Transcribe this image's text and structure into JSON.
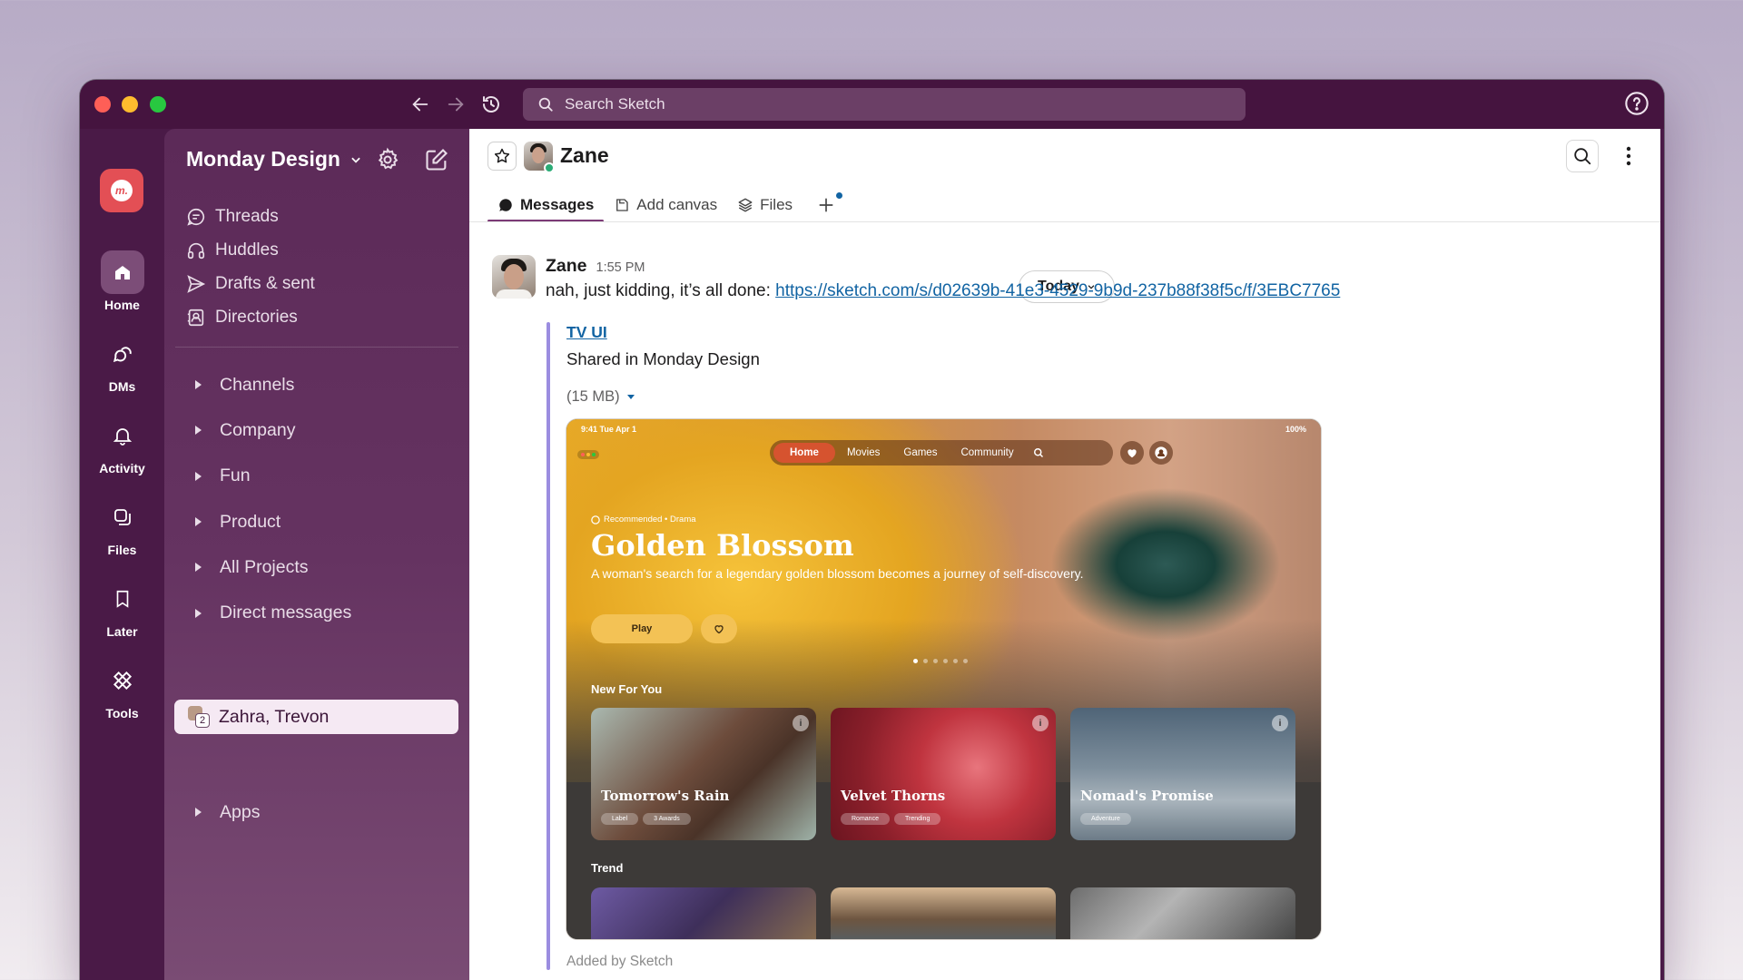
{
  "window": {
    "search_placeholder": "Search Sketch"
  },
  "rail": {
    "workspace_initial": "m.",
    "items": [
      {
        "label": "Home",
        "icon": "home-icon",
        "active": true
      },
      {
        "label": "DMs",
        "icon": "dms-icon",
        "active": false
      },
      {
        "label": "Activity",
        "icon": "bell-icon",
        "active": false
      },
      {
        "label": "Files",
        "icon": "files-icon",
        "active": false
      },
      {
        "label": "Later",
        "icon": "bookmark-icon",
        "active": false
      },
      {
        "label": "Tools",
        "icon": "tools-icon",
        "active": false
      }
    ]
  },
  "sidebar": {
    "workspace_name": "Monday Design",
    "nav": [
      {
        "label": "Threads",
        "icon": "threads-icon"
      },
      {
        "label": "Huddles",
        "icon": "headphones-icon"
      },
      {
        "label": "Drafts & sent",
        "icon": "send-icon"
      },
      {
        "label": "Directories",
        "icon": "directory-icon"
      }
    ],
    "sections": [
      "Channels",
      "Company",
      "Fun",
      "Product",
      "All Projects",
      "Direct messages"
    ],
    "dm_active": {
      "label": "Zahra, Trevon",
      "count": "2"
    },
    "apps_label": "Apps"
  },
  "channel": {
    "name": "Zane",
    "tabs": [
      {
        "label": "Messages",
        "active": true
      },
      {
        "label": "Add canvas",
        "active": false
      },
      {
        "label": "Files",
        "active": false
      }
    ]
  },
  "divider": {
    "label": "Today"
  },
  "message": {
    "author": "Zane",
    "time": "1:55 PM",
    "text": "nah, just kidding, it’s all done: ",
    "link": "https://sketch.com/s/d02639b-41e3-4529-9b9d-237b88f38f5c/f/3EBC7765",
    "attachment": {
      "title": "TV UI",
      "subtitle": "Shared in Monday Design",
      "size": "(15 MB)",
      "footer": "Added by Sketch"
    }
  },
  "preview": {
    "status_time": "9:41  Tue Apr 1",
    "battery": "100%",
    "nav": [
      "Home",
      "Movies",
      "Games",
      "Community"
    ],
    "tag": "Recommended • Drama",
    "title": "Golden Blossom",
    "description": "A woman's search for a legendary golden blossom becomes a journey of self-discovery.",
    "play_label": "Play",
    "section_new": "New For You",
    "section_trend": "Trend",
    "cards": [
      {
        "title": "Tomorrow's Rain",
        "chips": [
          "Label",
          "3 Awards"
        ]
      },
      {
        "title": "Velvet Thorns",
        "chips": [
          "Romance",
          "Trending"
        ]
      },
      {
        "title": "Nomad's Promise",
        "chips": [
          "Adventure"
        ]
      }
    ]
  }
}
